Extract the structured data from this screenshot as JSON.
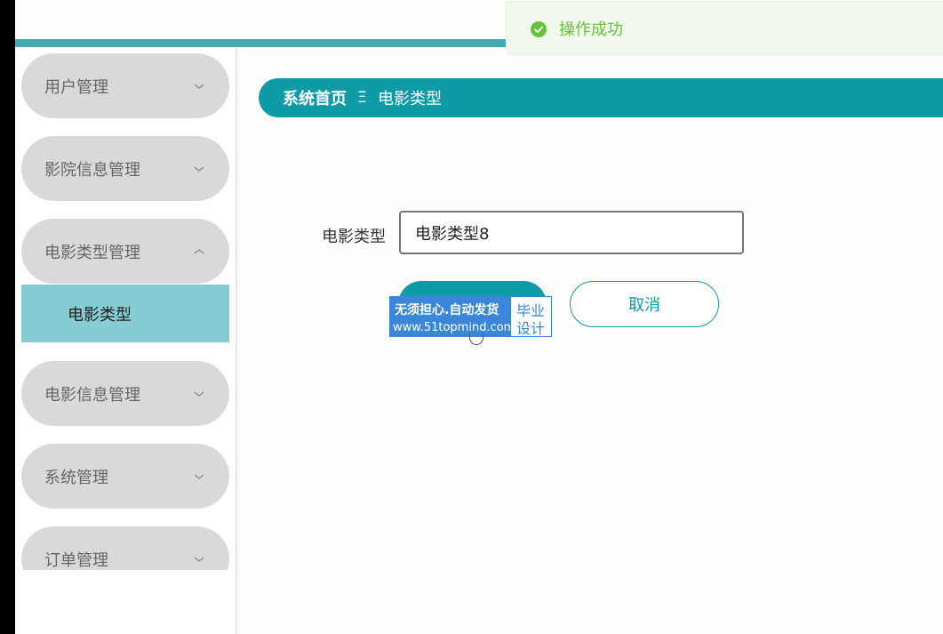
{
  "toast": {
    "message": "操作成功",
    "icon": "check-circle-icon",
    "color": "#67c23a"
  },
  "sidebar": {
    "items": [
      {
        "label": "用户管理",
        "icon": "chevron-down-icon"
      },
      {
        "label": "影院信息管理",
        "icon": "chevron-down-icon"
      },
      {
        "label": "电影类型管理",
        "icon": "chevron-up-icon",
        "expanded": true
      },
      {
        "label": "电影信息管理",
        "icon": "chevron-down-icon"
      },
      {
        "label": "系统管理",
        "icon": "chevron-down-icon"
      },
      {
        "label": "订单管理",
        "icon": "chevron-down-icon"
      }
    ],
    "submenu_active": "电影类型"
  },
  "breadcrumb": {
    "home": "系统首页",
    "separator": "Ξ",
    "current": "电影类型"
  },
  "form": {
    "label": "电影类型",
    "value": "电影类型8",
    "cancel_label": "取消"
  },
  "watermark": {
    "line1": "无须担心.自动发货",
    "line2": "www.51topmind.com",
    "tag1": "毕业",
    "tag2": "设计"
  },
  "colors": {
    "accent": "#0e9aa7",
    "submenu_bg": "#86ccd3",
    "menu_bg": "#d9d9d9",
    "topline": "#45a9b0"
  }
}
